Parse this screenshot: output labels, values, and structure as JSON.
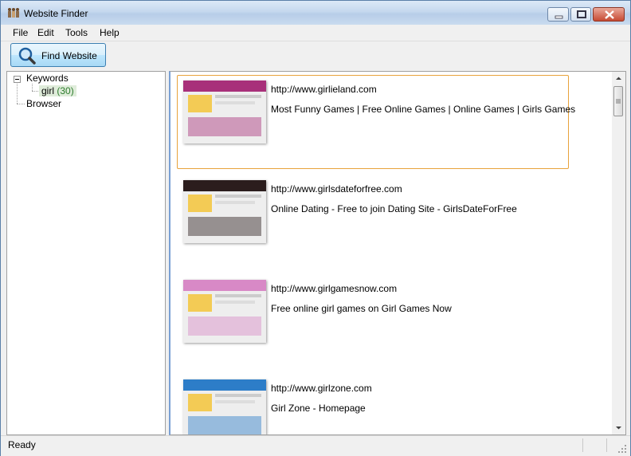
{
  "window": {
    "title": "Website Finder"
  },
  "menu": [
    "File",
    "Edit",
    "Tools",
    "Help"
  ],
  "toolbar": {
    "find_label": "Find Website"
  },
  "tree": {
    "keywords_label": "Keywords",
    "keyword": {
      "label": "girl",
      "count": "(30)"
    },
    "browser_label": "Browser"
  },
  "results": [
    {
      "url": "http://www.girlieland.com",
      "title": "Most Funny Games | Free Online Games | Online Games | Girls Games",
      "thumb_color": "#a8307a",
      "selected": true
    },
    {
      "url": "http://www.girlsdateforfree.com",
      "title": "Online Dating - Free to join Dating Site - GirlsDateForFree",
      "thumb_color": "#2b1d1d",
      "selected": false
    },
    {
      "url": "http://www.girlgamesnow.com",
      "title": "Free online girl games on Girl Games Now",
      "thumb_color": "#d889c6",
      "selected": false
    },
    {
      "url": "http://www.girlzone.com",
      "title": "Girl Zone - Homepage",
      "thumb_color": "#2d7dc8",
      "selected": false
    }
  ],
  "status": {
    "text": "Ready"
  },
  "colors": {
    "selection_border": "#e8a33b",
    "accent": "#3c7fb1"
  }
}
